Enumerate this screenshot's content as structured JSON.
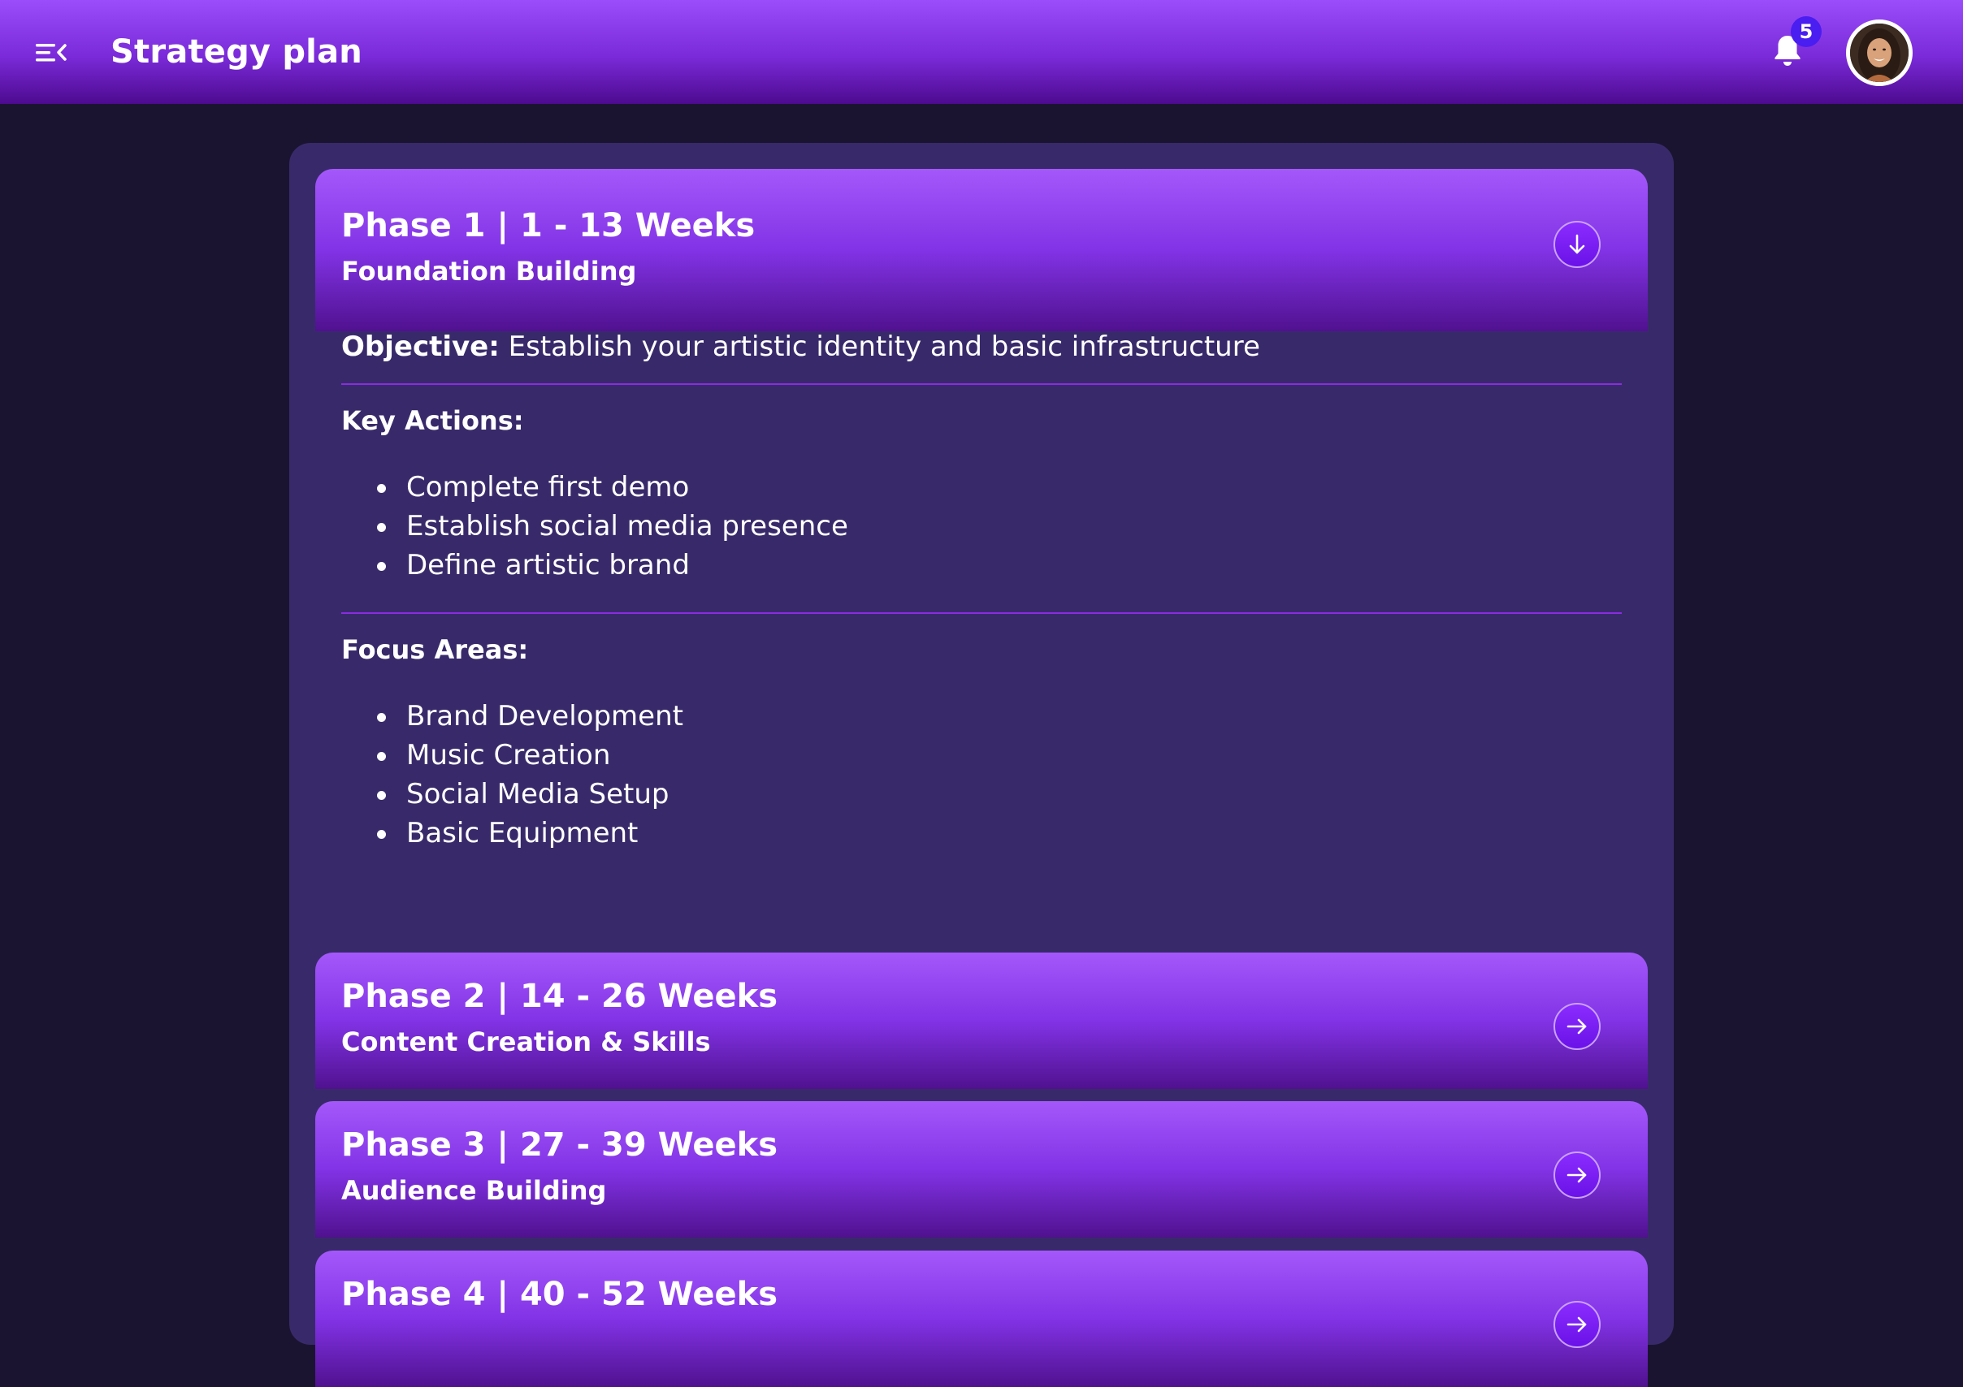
{
  "header": {
    "title": "Strategy plan",
    "notification_count": "5",
    "menu_icon": "menu-collapse-icon",
    "bell_icon": "bell-icon",
    "avatar": "user-avatar"
  },
  "colors": {
    "accent": "#9b4dfb",
    "background": "#1b1430",
    "panel": "#382a6a",
    "badge": "#4a1df0",
    "divider": "#8a2be2"
  },
  "phases": [
    {
      "title": "Phase 1 | 1 - 13 Weeks",
      "subtitle": "Foundation Building",
      "expanded": true,
      "toggle_icon": "arrow-down-icon",
      "objective_label": "Objective:",
      "objective_text": "Establish your artistic identity and basic infrastructure",
      "key_actions_label": "Key Actions:",
      "key_actions": [
        "Complete first demo",
        "Establish social media presence",
        "Define artistic brand"
      ],
      "focus_areas_label": "Focus Areas:",
      "focus_areas": [
        "Brand Development",
        "Music Creation",
        "Social Media Setup",
        "Basic Equipment"
      ]
    },
    {
      "title": "Phase 2 | 14 - 26 Weeks",
      "subtitle": "Content Creation & Skills",
      "expanded": false,
      "toggle_icon": "arrow-right-icon"
    },
    {
      "title": "Phase 3 | 27 - 39 Weeks",
      "subtitle": "Audience Building",
      "expanded": false,
      "toggle_icon": "arrow-right-icon"
    },
    {
      "title": "Phase 4 | 40 - 52 Weeks",
      "subtitle": "",
      "expanded": false,
      "toggle_icon": "arrow-right-icon"
    }
  ]
}
